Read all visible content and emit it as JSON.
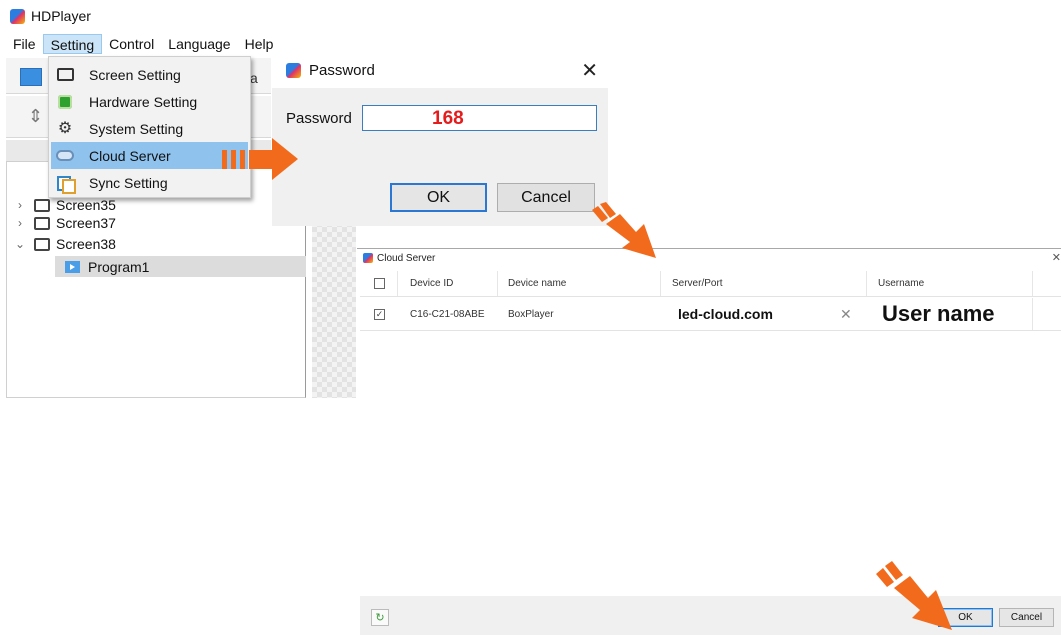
{
  "app": {
    "title": "HDPlayer"
  },
  "menubar": {
    "file": "File",
    "setting": "Setting",
    "control": "Control",
    "language": "Language",
    "help": "Help"
  },
  "toolbar": {
    "partial_text": "a"
  },
  "setting_menu": {
    "items": [
      {
        "label": "Screen Setting",
        "icon": "monitor-icon"
      },
      {
        "label": "Hardware Setting",
        "icon": "chip-icon"
      },
      {
        "label": "System Setting",
        "icon": "gear-icon"
      },
      {
        "label": "Cloud Server",
        "icon": "cloud-icon",
        "highlighted": true
      },
      {
        "label": "Sync Setting",
        "icon": "sync-icon"
      }
    ]
  },
  "tree": {
    "screens": [
      {
        "label": "Screen35",
        "expanded": false
      },
      {
        "label": "Screen37",
        "expanded": false
      },
      {
        "label": "Screen38",
        "expanded": true
      }
    ],
    "program": "Program1"
  },
  "password_dialog": {
    "title": "Password",
    "label": "Password",
    "value": "168",
    "ok": "OK",
    "cancel": "Cancel"
  },
  "cloud_server": {
    "title": "Cloud Server",
    "columns": [
      "Device ID",
      "Device name",
      "Server/Port",
      "Username"
    ],
    "rows": [
      {
        "checked": true,
        "device_id": "C16-C21-08ABE",
        "device_name": "BoxPlayer",
        "server": "led-cloud.com",
        "username": "User name"
      }
    ],
    "ok": "OK",
    "cancel": "Cancel"
  },
  "colors": {
    "accent_arrow": "#f26b1d",
    "menu_highlight": "#8fc3ee",
    "password_value": "#e51c1c",
    "ok_border": "#2a78d3"
  }
}
